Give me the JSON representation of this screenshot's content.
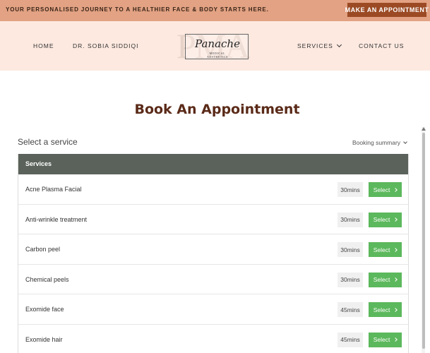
{
  "topbar": {
    "tagline": "YOUR PERSONALISED JOURNEY TO A HEALTHIER FACE & BODY STARTS HERE.",
    "cta": "MAKE AN APPOINTMENT"
  },
  "nav": {
    "home": "HOME",
    "doctor": "DR. SOBIA SIDDIQI",
    "services": "SERVICES",
    "contact": "CONTACT US"
  },
  "logo": {
    "monogram": "PMA",
    "script": "Panache",
    "line1": "MEDICAL",
    "line2": "AESTHETICS"
  },
  "page_title": "Book An Appointment",
  "booking": {
    "section_title": "Select a service",
    "summary_label": "Booking summary",
    "table_header": "Services",
    "select_label": "Select",
    "services": [
      {
        "name": "Acne Plasma Facial",
        "duration": "30mins"
      },
      {
        "name": "Anti-wrinkle treatment",
        "duration": "30mins"
      },
      {
        "name": "Carbon peel",
        "duration": "30mins"
      },
      {
        "name": "Chemical peels",
        "duration": "30mins"
      },
      {
        "name": "Exomide face",
        "duration": "45mins"
      },
      {
        "name": "Exomide hair",
        "duration": "45mins"
      }
    ]
  },
  "colors": {
    "topbar": "#e2a283",
    "cta": "#9b4a24",
    "nav_bg": "#fde9e0",
    "title": "#5a2a18",
    "table_header": "#5b625b",
    "select_button": "#5cb85c"
  }
}
